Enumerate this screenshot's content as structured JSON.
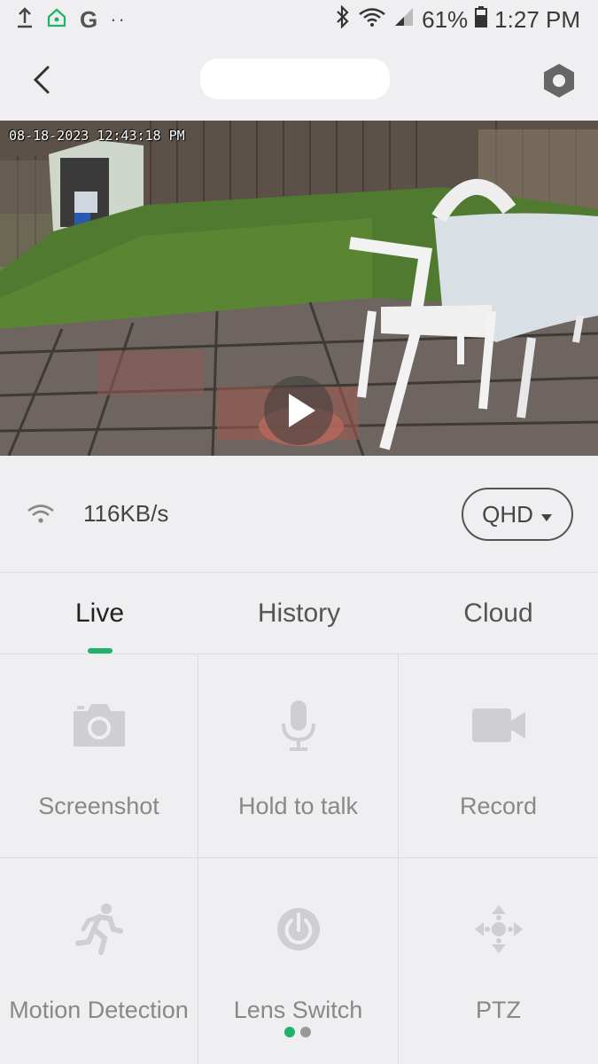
{
  "status_bar": {
    "left_icons": [
      "upload-icon",
      "home-icon",
      "google-icon",
      "more-dots-icon"
    ],
    "google_letter": "G",
    "dots": "··",
    "battery_percent": "61%",
    "time": "1:27 PM"
  },
  "header": {
    "back_icon": "back-chevron-icon",
    "settings_icon": "settings-hexagon-icon"
  },
  "feed": {
    "timestamp": "08-18-2023 12:43:18 PM",
    "play_icon": "play-icon"
  },
  "network": {
    "speed": "116KB/s",
    "quality": "QHD"
  },
  "tabs": [
    {
      "label": "Live",
      "active": true
    },
    {
      "label": "History",
      "active": false
    },
    {
      "label": "Cloud",
      "active": false
    }
  ],
  "controls": [
    {
      "label": "Screenshot",
      "icon": "camera-icon"
    },
    {
      "label": "Hold to talk",
      "icon": "microphone-icon"
    },
    {
      "label": "Record",
      "icon": "video-camera-icon"
    },
    {
      "label": "Motion Detection",
      "icon": "running-person-icon"
    },
    {
      "label": "Lens Switch",
      "icon": "power-icon"
    },
    {
      "label": "PTZ",
      "icon": "direction-pad-icon"
    }
  ],
  "pager": {
    "pages": 2,
    "current": 1
  },
  "colors": {
    "accent": "#21b26a",
    "background": "#efeff1",
    "icon_gray": "#cfcfd2"
  }
}
